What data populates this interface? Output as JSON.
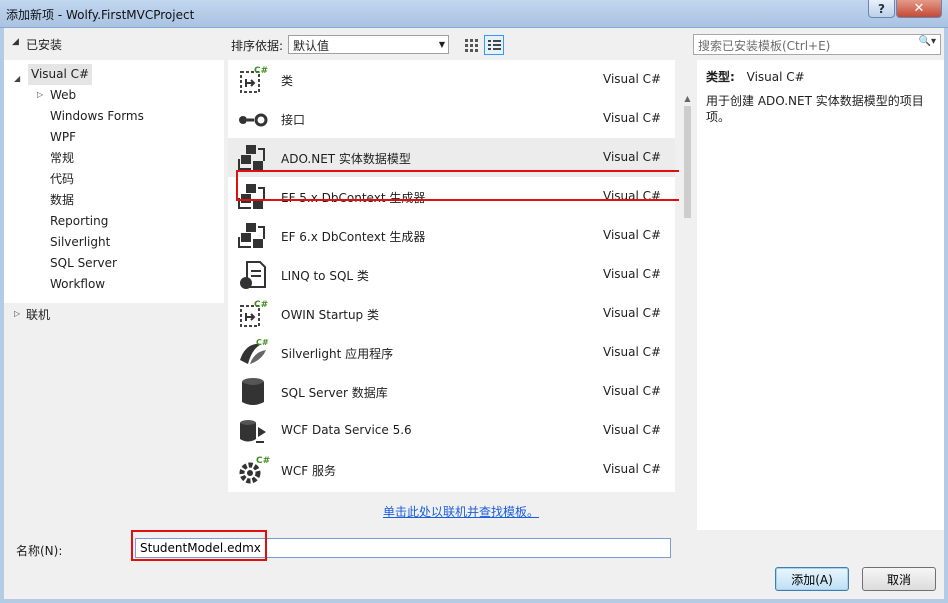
{
  "window": {
    "title": "添加新项 - Wolfy.FirstMVCProject",
    "help_label": "?",
    "close_label": "✕"
  },
  "tree": {
    "header": "已安装",
    "items": [
      {
        "label": "Visual C#",
        "expander": "◢",
        "selected": true
      },
      {
        "label": "Web",
        "expander": "▷"
      },
      {
        "label": "Windows Forms"
      },
      {
        "label": "WPF"
      },
      {
        "label": "常规"
      },
      {
        "label": "代码"
      },
      {
        "label": "数据"
      },
      {
        "label": "Reporting"
      },
      {
        "label": "Silverlight"
      },
      {
        "label": "SQL Server"
      },
      {
        "label": "Workflow"
      }
    ],
    "online": {
      "label": "联机",
      "expander": "▷"
    }
  },
  "sort": {
    "label": "排序依据:",
    "value": "默认值"
  },
  "search": {
    "placeholder": "搜索已安装模板(Ctrl+E)"
  },
  "templates": [
    {
      "name": "类",
      "lang": "Visual C#",
      "icon": "class-icon"
    },
    {
      "name": "接口",
      "lang": "Visual C#",
      "icon": "interface-icon"
    },
    {
      "name": "ADO.NET 实体数据模型",
      "lang": "Visual C#",
      "icon": "entity-model-icon",
      "selected": true
    },
    {
      "name": "EF 5.x DbContext 生成器",
      "lang": "Visual C#",
      "icon": "dbcontext-generator-icon"
    },
    {
      "name": "EF 6.x DbContext 生成器",
      "lang": "Visual C#",
      "icon": "dbcontext-generator-icon"
    },
    {
      "name": "LINQ to SQL 类",
      "lang": "Visual C#",
      "icon": "linq-to-sql-icon"
    },
    {
      "name": "OWIN Startup 类",
      "lang": "Visual C#",
      "icon": "class-icon"
    },
    {
      "name": "Silverlight 应用程序",
      "lang": "Visual C#",
      "icon": "silverlight-app-icon"
    },
    {
      "name": "SQL Server 数据库",
      "lang": "Visual C#",
      "icon": "database-icon"
    },
    {
      "name": "WCF Data Service 5.6",
      "lang": "Visual C#",
      "icon": "data-service-icon"
    },
    {
      "name": "WCF 服务",
      "lang": "Visual C#",
      "icon": "wcf-service-icon"
    }
  ],
  "online_link": "单击此处以联机并查找模板。",
  "details": {
    "type_label": "类型:",
    "type_value": "Visual C#",
    "description": "用于创建 ADO.NET 实体数据模型的项目项。"
  },
  "name_field": {
    "label": "名称(N):",
    "value": "StudentModel.edmx"
  },
  "buttons": {
    "add": "添加(A)",
    "cancel": "取消"
  },
  "colors": {
    "highlight": "#e01010",
    "link": "#1a5edc",
    "selection": "#ececec"
  }
}
